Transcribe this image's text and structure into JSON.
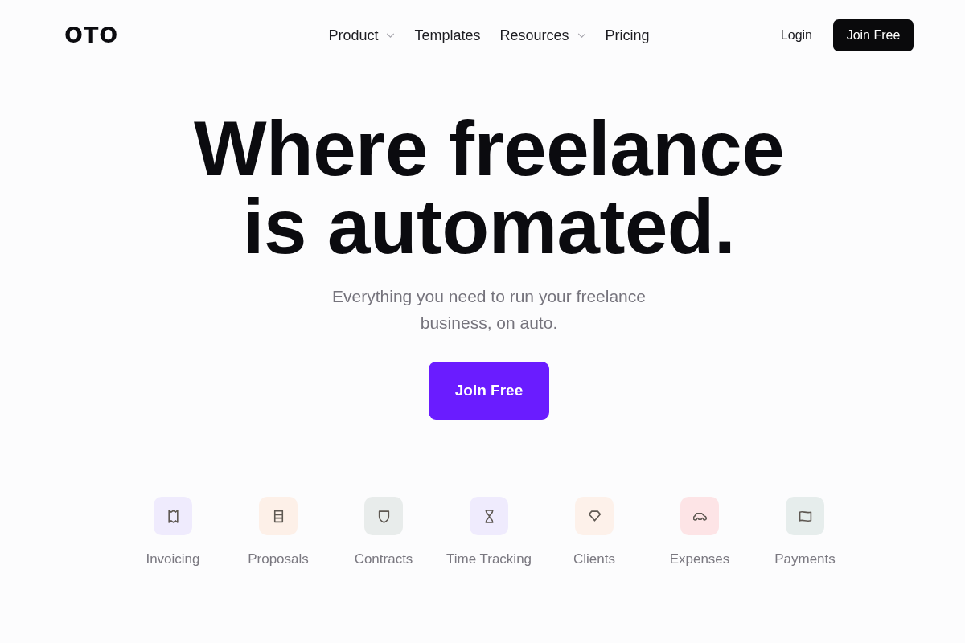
{
  "logo": {
    "text": "OTO"
  },
  "nav": {
    "links": [
      {
        "label": "Product",
        "has_menu": true
      },
      {
        "label": "Templates",
        "has_menu": false
      },
      {
        "label": "Resources",
        "has_menu": true
      },
      {
        "label": "Pricing",
        "has_menu": false
      }
    ],
    "login": "Login",
    "cta": "Join Free"
  },
  "hero": {
    "title": "Where freelance is automated.",
    "subtitle": "Everything you need to run your freelance business, on auto.",
    "cta": "Join Free"
  },
  "features": [
    {
      "label": "Invoicing",
      "kind": "receipt",
      "color": "#efebfd"
    },
    {
      "label": "Proposals",
      "kind": "list",
      "color": "#fdf0e8"
    },
    {
      "label": "Contracts",
      "kind": "shield",
      "color": "#e8eceb"
    },
    {
      "label": "Time Tracking",
      "kind": "hourglass",
      "color": "#efebfd"
    },
    {
      "label": "Clients",
      "kind": "diamond",
      "color": "#fdf1ea"
    },
    {
      "label": "Expenses",
      "kind": "car",
      "color": "#fde4e6"
    },
    {
      "label": "Payments",
      "kind": "flag",
      "color": "#e6edec"
    }
  ]
}
